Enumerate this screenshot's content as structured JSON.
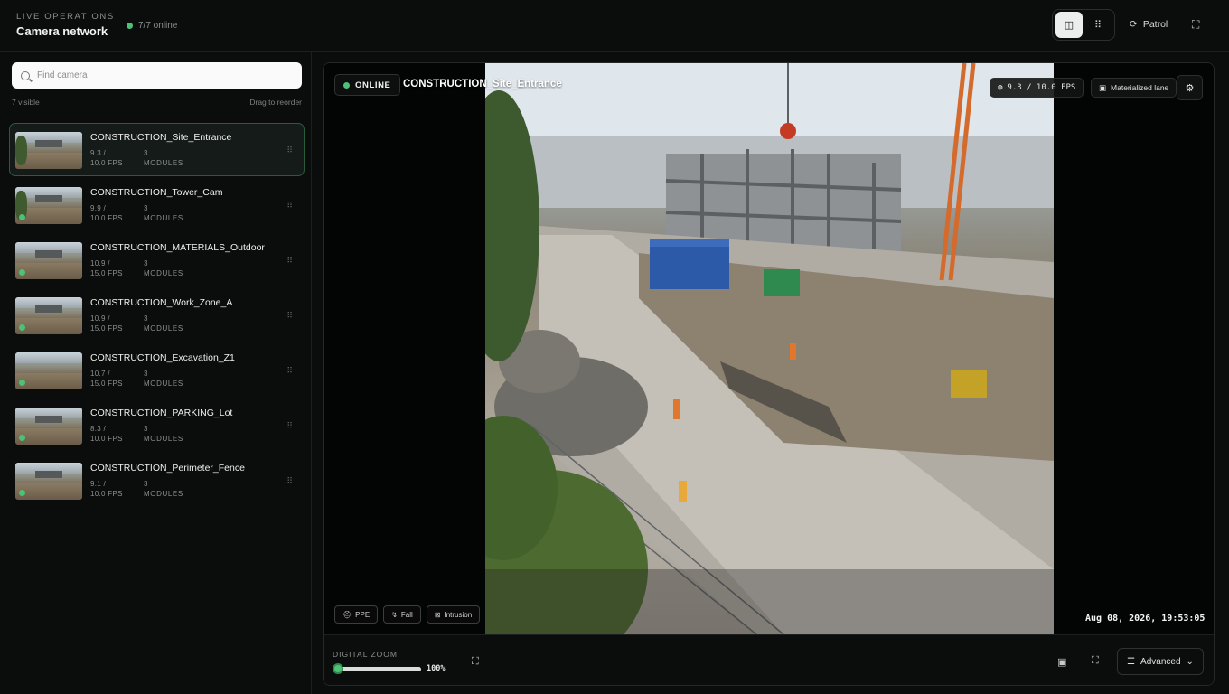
{
  "header": {
    "eyebrow": "LIVE OPERATIONS",
    "title": "Camera network",
    "online_status": "7/7 online",
    "patrol_label": "Patrol",
    "tools": [
      {
        "icon": "grid-single-icon",
        "glyph": "◫",
        "active": true
      },
      {
        "icon": "grid-multi-icon",
        "glyph": "⠿",
        "active": false
      }
    ],
    "patrol_glyph": "⟳",
    "expand_glyph": "⛶"
  },
  "sidebar": {
    "search_placeholder": "Find camera",
    "visible_count": "7 visible",
    "reorder_hint": "Drag to reorder",
    "cameras": [
      {
        "name": "CONSTRUCTION_Site_Entrance",
        "fps_top": "9.3 /",
        "fps_bottom": "10.0 FPS",
        "modules_top": "3",
        "modules_bottom": "MODULES",
        "selected": true,
        "online": false
      },
      {
        "name": "CONSTRUCTION_Tower_Cam",
        "fps_top": "9.9 /",
        "fps_bottom": "10.0 FPS",
        "modules_top": "3",
        "modules_bottom": "MODULES",
        "selected": false,
        "online": true
      },
      {
        "name": "CONSTRUCTION_MATERIALS_Outdoor",
        "fps_top": "10.9 /",
        "fps_bottom": "15.0 FPS",
        "modules_top": "3",
        "modules_bottom": "MODULES",
        "selected": false,
        "online": true
      },
      {
        "name": "CONSTRUCTION_Work_Zone_A",
        "fps_top": "10.9 /",
        "fps_bottom": "15.0 FPS",
        "modules_top": "3",
        "modules_bottom": "MODULES",
        "selected": false,
        "online": true
      },
      {
        "name": "CONSTRUCTION_Excavation_Z1",
        "fps_top": "10.7 /",
        "fps_bottom": "15.0 FPS",
        "modules_top": "3",
        "modules_bottom": "MODULES",
        "selected": false,
        "online": true
      },
      {
        "name": "CONSTRUCTION_PARKING_Lot",
        "fps_top": "8.3 /",
        "fps_bottom": "10.0 FPS",
        "modules_top": "3",
        "modules_bottom": "MODULES",
        "selected": false,
        "online": true
      },
      {
        "name": "CONSTRUCTION_Perimeter_Fence",
        "fps_top": "9.1 /",
        "fps_bottom": "10.0 FPS",
        "modules_top": "3",
        "modules_bottom": "MODULES",
        "selected": false,
        "online": true
      }
    ]
  },
  "feed": {
    "status": "ONLINE",
    "camera_name": "CONSTRUCTION_Site_Entrance",
    "fps_readout": "9.3 / 10.0 FPS",
    "mask_label": "Materialized lane",
    "timestamp": "Aug 08, 2026, 19:53:05",
    "chips": [
      {
        "label": "PPE",
        "icon": "helmet-icon",
        "glyph": "⛑"
      },
      {
        "label": "Fall",
        "icon": "fall-icon",
        "glyph": "↯"
      },
      {
        "label": "Intrusion",
        "icon": "intrusion-icon",
        "glyph": "⊠"
      }
    ]
  },
  "controls": {
    "zoom_label": "DIGITAL ZOOM",
    "zoom_value": "100%",
    "zoom_level": 0.0,
    "advanced_label": "Advanced",
    "advanced_glyph": "☰",
    "chevron_glyph": "⌄"
  },
  "colors": {
    "accent_green": "#4ec274",
    "selected_border": "#2c5b3c",
    "background": "#0b0c0c"
  }
}
